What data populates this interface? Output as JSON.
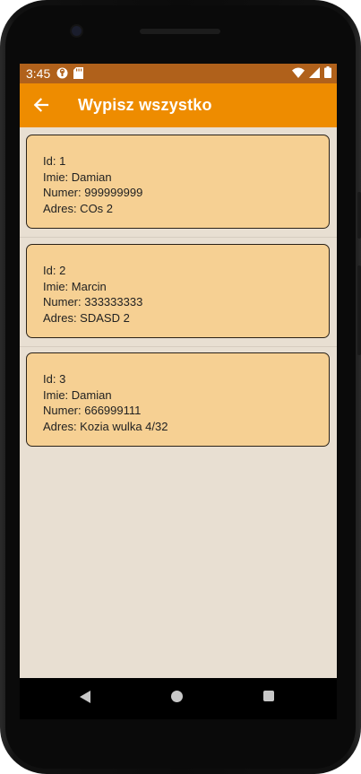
{
  "status_bar": {
    "time": "3:45",
    "left_icons": [
      "signal-tower-icon",
      "sd-card-icon"
    ],
    "right_icons": [
      "wifi-icon",
      "cell-signal-icon",
      "battery-icon"
    ]
  },
  "app_bar": {
    "title": "Wypisz wszystko",
    "back_icon": "arrow-left-icon",
    "color": "#ee8c00"
  },
  "records": [
    {
      "id_line": "Id: 1",
      "name_line": "Imie: Damian",
      "number_line": "Numer: 999999999",
      "address_line": "Adres: COs 2"
    },
    {
      "id_line": "Id: 2",
      "name_line": "Imie: Marcin",
      "number_line": "Numer: 333333333",
      "address_line": "Adres: SDASD 2"
    },
    {
      "id_line": "Id: 3",
      "name_line": "Imie: Damian",
      "number_line": "Numer: 666999111",
      "address_line": "Adres: Kozia wulka 4/32"
    }
  ],
  "colors": {
    "card_fill": "#f6d093",
    "screen_background": "#e8dfd2",
    "status_bar": "#b0611b"
  },
  "nav_bar": {
    "icons": [
      "nav-back-icon",
      "nav-home-icon",
      "nav-recents-icon"
    ]
  }
}
